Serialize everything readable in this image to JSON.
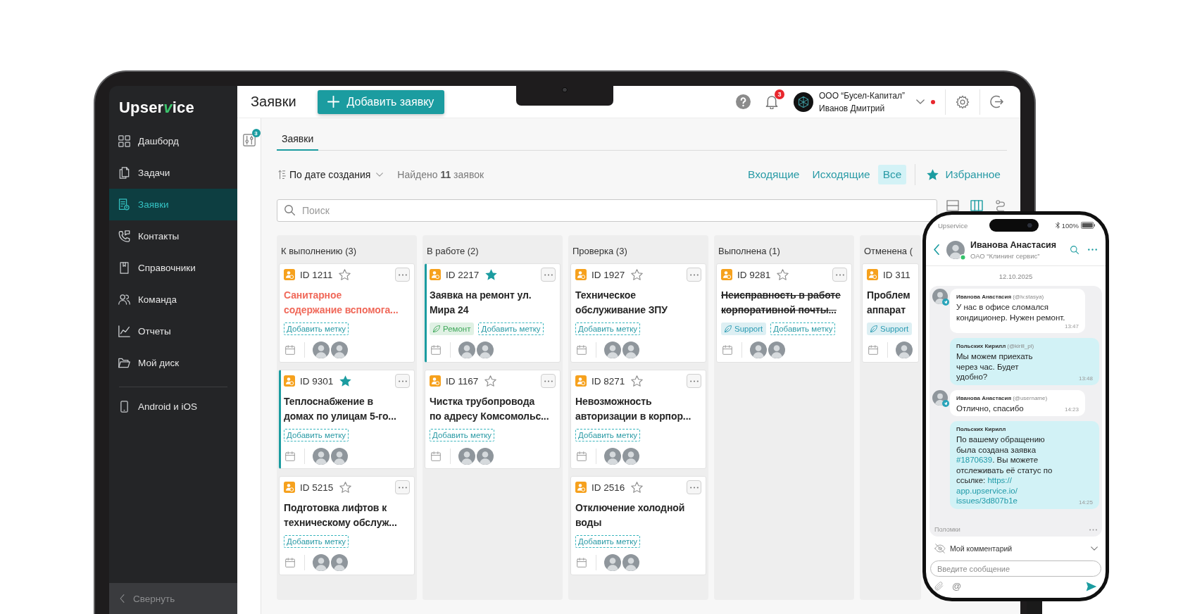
{
  "laptop": {
    "sidebar": {
      "logo": {
        "start": "Upser",
        "mark": "v",
        "end": "ice"
      },
      "items": [
        {
          "kind": "dashboard",
          "label": "Дашборд",
          "selected": false
        },
        {
          "kind": "tasks",
          "label": "Задачи",
          "selected": false
        },
        {
          "kind": "requests",
          "label": "Заявки",
          "selected": true
        },
        {
          "kind": "contacts",
          "label": "Контакты",
          "selected": false
        },
        {
          "kind": "directories",
          "label": "Справочники",
          "selected": false
        },
        {
          "kind": "team",
          "label": "Команда",
          "selected": false
        },
        {
          "kind": "reports",
          "label": "Отчеты",
          "selected": false
        },
        {
          "kind": "drive",
          "label": "Мой диск",
          "selected": false
        }
      ],
      "extra_items": [
        {
          "kind": "mobile",
          "label": "Android и iOS",
          "selected": false
        }
      ],
      "collapse": "Свернуть"
    },
    "header": {
      "title": "Заявки",
      "add_button": "Добавить заявку",
      "notifications": "3",
      "org": "ООО “Бусел-Капитал”",
      "user": "Иванов Дмитрий",
      "alert": true
    },
    "filters_badge": "3",
    "tabs": [
      {
        "label": "Заявки",
        "selected": true
      }
    ],
    "sort": {
      "label": "По дате создания",
      "found": "Найдено **11** заявок"
    },
    "scopes": [
      {
        "label": "Входящие",
        "selected": false
      },
      {
        "label": "Исходящие",
        "selected": false
      },
      {
        "label": "Все",
        "selected": true
      }
    ],
    "favorites": "Избранное",
    "search": {
      "placeholder": "Поиск"
    },
    "view_modes": [
      {
        "kind": "list",
        "selected": false
      },
      {
        "kind": "board",
        "selected": true
      },
      {
        "kind": "route",
        "selected": false
      }
    ],
    "board": {
      "columns": [
        {
          "title": "К выполнению (3)",
          "cards": [
            {
              "id": "ID 1211",
              "starred": false,
              "title": "Санитарное\nсодержание вспомога...",
              "overdue": true,
              "completed": false,
              "add_tag": "Добавить метку",
              "assignees": [
                {
                  "kind": "photo"
                },
                {
                  "kind": "photo"
                }
              ]
            },
            {
              "id": "ID 9301",
              "starred": true,
              "title": "Теплоснабжение в\nдомах по улицам 5-го...",
              "overdue": false,
              "completed": false,
              "add_tag": "Добавить метку",
              "assignees": [
                {
                  "kind": "photo"
                },
                {
                  "kind": "photo"
                }
              ]
            },
            {
              "id": "ID 5215",
              "starred": false,
              "title": "Подготовка лифтов к\nтехническому обслуж...",
              "overdue": false,
              "completed": false,
              "add_tag": "Добавить метку",
              "assignees": [
                {
                  "kind": "photo"
                },
                {
                  "kind": "photo"
                }
              ]
            }
          ]
        },
        {
          "title": "В работе (2)",
          "cards": [
            {
              "id": "ID 2217",
              "starred": true,
              "title": "Заявка на ремонт ул.\nМира 24",
              "overdue": false,
              "completed": false,
              "tags": [
                {
                  "label": "Ремонт",
                  "color": "#3fa85a"
                }
              ],
              "add_tag": "Добавить метку",
              "assignees": [
                {
                  "kind": "photo"
                },
                {
                  "kind": "photo"
                }
              ]
            },
            {
              "id": "ID 1167",
              "starred": false,
              "title": "Чистка трубопровода\nпо адресу Комсомольс...",
              "overdue": false,
              "completed": false,
              "add_tag": "Добавить метку",
              "assignees": [
                {
                  "kind": "photo"
                },
                {
                  "kind": "photo"
                }
              ]
            }
          ]
        },
        {
          "title": "Проверка (3)",
          "cards": [
            {
              "id": "ID 1927",
              "starred": false,
              "title": "Техническое\nобслуживание ЗПУ",
              "overdue": false,
              "completed": false,
              "add_tag": "Добавить метку",
              "assignees": [
                {
                  "kind": "photo"
                },
                {
                  "kind": "photo"
                }
              ]
            },
            {
              "id": "ID 8271",
              "starred": false,
              "title": "Невозможность\nавторизации в корпор...",
              "overdue": false,
              "completed": false,
              "add_tag": "Добавить метку",
              "assignees": [
                {
                  "kind": "photo"
                },
                {
                  "kind": "photo"
                }
              ]
            },
            {
              "id": "ID 2516",
              "starred": false,
              "title": "Отключение холодной\nводы",
              "overdue": false,
              "completed": false,
              "add_tag": "Добавить метку",
              "assignees": [
                {
                  "kind": "photo"
                },
                {
                  "kind": "photo"
                }
              ]
            }
          ]
        },
        {
          "title": "Выполнена (1)",
          "cards": [
            {
              "id": "ID 9281",
              "starred": false,
              "title": "Неисправность в работе\nкорпоративной почты...",
              "overdue": false,
              "completed": true,
              "tags": [
                {
                  "label": "Support",
                  "color": "#2a9bb3"
                }
              ],
              "add_tag": "Добавить метку",
              "assignees": [
                {
                  "kind": "photo"
                },
                {
                  "kind": "photo"
                }
              ]
            }
          ]
        },
        {
          "title": "Отменена (",
          "cards": [
            {
              "id": "ID 311",
              "title": "Проблем\nаппарат",
              "overdue": false,
              "completed": false,
              "tags": [
                {
                  "label": "Support",
                  "color": "#2a9bb3"
                }
              ],
              "assignees": [
                {
                  "kind": "photo"
                }
              ]
            }
          ]
        }
      ]
    }
  },
  "phone": {
    "status_bar": {
      "app": "Upservice",
      "battery": "100%"
    },
    "contact": {
      "name": "Иванова Анастасия",
      "company": "ОАО “Клининг сервис”",
      "online": true
    },
    "date": "12.10.2025",
    "messages": [
      {
        "kind": "incoming",
        "author": "Иванова Анастасия",
        "handle": "(@lv.stasya)",
        "parts": [
          {
            "kind": "text",
            "text": "У нас в офисе сломался\nкондиционер. Нужен ремонт."
          }
        ],
        "time": "13:47"
      },
      {
        "kind": "outgoing",
        "author": "Польских Кирилл",
        "handle": "(@kirill_pl)",
        "parts": [
          {
            "kind": "text",
            "text": "Мы можем приехать\nчерез час. Будет\nудобно?"
          }
        ],
        "time": "13:48"
      },
      {
        "kind": "incoming",
        "author": "Иванова Анастасия",
        "handle": "(@username)",
        "parts": [
          {
            "kind": "text",
            "text": "Отлично, спасибо"
          }
        ],
        "time": "14:23"
      },
      {
        "kind": "outgoing",
        "author": "Польских Кирилл",
        "parts": [
          {
            "kind": "text",
            "text": "По вашему обращению\nбыла создана заявка\n"
          },
          {
            "kind": "link",
            "text": "#1870639"
          },
          {
            "kind": "text",
            "text": ". Вы можете\nотслеживать её статус по\nссылке: "
          },
          {
            "kind": "link",
            "text": "https://"
          },
          {
            "kind": "link",
            "text": "app.upservice.io/"
          },
          {
            "kind": "link",
            "text": "issues/3d807b1e"
          }
        ],
        "time": "14:25"
      }
    ],
    "topic": "Поломки",
    "comment_mode": "Мой комментарий",
    "input": {
      "placeholder": "Введите сообщение"
    },
    "mention": "@"
  }
}
